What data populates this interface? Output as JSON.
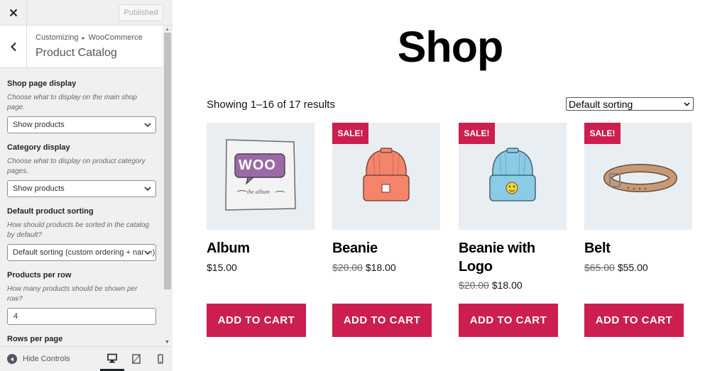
{
  "customizer": {
    "published_label": "Published",
    "breadcrumb": {
      "parent": "Customizing",
      "separator": "▸",
      "current": "WooCommerce"
    },
    "section_title": "Product Catalog",
    "controls": {
      "shop_page_display": {
        "label": "Shop page display",
        "description": "Choose what to display on the main shop page.",
        "value": "Show products"
      },
      "category_display": {
        "label": "Category display",
        "description": "Choose what to display on product category pages.",
        "value": "Show products"
      },
      "default_sorting": {
        "label": "Default product sorting",
        "description": "How should products be sorted in the catalog by default?",
        "value": "Default sorting (custom ordering + name)"
      },
      "products_per_row": {
        "label": "Products per row",
        "description": "How many products should be shown per row?",
        "value": "4"
      },
      "rows_per_page": {
        "label": "Rows per page"
      }
    },
    "footer": {
      "hide_controls_label": "Hide Controls",
      "devices": [
        "desktop-icon",
        "tablet-icon",
        "mobile-icon"
      ]
    }
  },
  "shop": {
    "title": "Shop",
    "result_count": "Showing 1–16 of 17 results",
    "sorting_value": "Default sorting",
    "sale_label": "SALE!",
    "add_to_cart_label": "ADD TO CART",
    "products": [
      {
        "name": "Album",
        "price": "$15.00",
        "old_price": "",
        "on_sale": false,
        "image": "woo-album"
      },
      {
        "name": "Beanie",
        "price": "$18.00",
        "old_price": "$20.00",
        "on_sale": true,
        "image": "orange-beanie"
      },
      {
        "name": "Beanie with Logo",
        "price": "$18.00",
        "old_price": "$20.00",
        "on_sale": true,
        "image": "blue-beanie-logo"
      },
      {
        "name": "Belt",
        "price": "$55.00",
        "old_price": "$65.00",
        "on_sale": true,
        "image": "leather-belt"
      }
    ]
  },
  "colors": {
    "accent": "#cc1e4f",
    "image_bg": "#e9eef2",
    "sidebar_bg": "#f0f0f1"
  }
}
